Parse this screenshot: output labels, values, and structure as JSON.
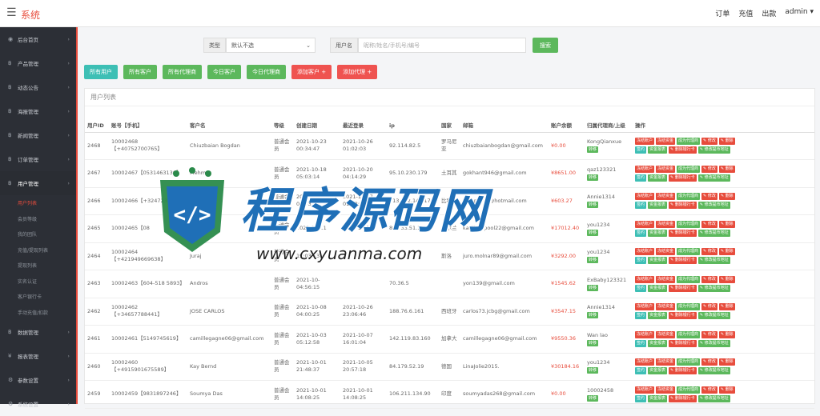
{
  "header": {
    "title": "系统",
    "links": [
      "订单",
      "充值",
      "出款"
    ],
    "user": "admin"
  },
  "sidebar": {
    "items": [
      {
        "label": "后台首页",
        "icon": "gauge-icon"
      },
      {
        "label": "产品管理",
        "icon": "bitcoin-icon"
      },
      {
        "label": "动态公告",
        "icon": "bitcoin-icon"
      },
      {
        "label": "海报管理",
        "icon": "bitcoin-icon"
      },
      {
        "label": "新闻管理",
        "icon": "bitcoin-icon"
      },
      {
        "label": "订单管理",
        "icon": "bitcoin-icon"
      },
      {
        "label": "用户管理",
        "icon": "bitcoin-icon"
      }
    ],
    "subitems": [
      "用户列表",
      "会员等级",
      "我的团队",
      "充值/提现列表",
      "提现列表",
      "实名认证",
      "客户银行卡",
      "手动充值/扣款"
    ],
    "items_after": [
      {
        "label": "数据管理",
        "icon": "bitcoin-icon"
      },
      {
        "label": "报表管理",
        "icon": "yen-icon"
      },
      {
        "label": "参数设置",
        "icon": "gear-icon"
      },
      {
        "label": "系统设置",
        "icon": "gears-icon"
      }
    ]
  },
  "filter": {
    "type_label": "类型",
    "type_value": "默认不选",
    "user_label": "用户名",
    "placeholder": "昵称/姓名/手机号/编号",
    "search": "搜索"
  },
  "buttons": [
    "所有用户",
    "所有客户",
    "所有代理商",
    "今日客户",
    "今日代理商",
    "添加客户 +",
    "添加代理 +"
  ],
  "panel_title": "用户列表",
  "columns": [
    "用户ID",
    "账号【手机】",
    "客户名",
    "等级",
    "创建日期",
    "最近登录",
    "ip",
    "国家",
    "邮箱",
    "账户余额",
    "归属代理商/上级",
    "操作"
  ],
  "rows": [
    {
      "id": "2468",
      "acct": "10002468【+40752700765】",
      "name": "Chiuzbaian Bogdan",
      "level": "普通会员",
      "created": "2021-10-23 00:34:47",
      "login": "2021-10-26 01:02:03",
      "ip": "92.114.82.5",
      "country": "罗马尼亚",
      "email": "chiuzbaianbogdan@gmail.com",
      "balance": "¥0.00",
      "agent": "KongQianxue"
    },
    {
      "id": "2467",
      "acct": "10002467【0531463136】",
      "name": "Mehmet",
      "level": "普通会员",
      "created": "2021-10-18 05:03:14",
      "login": "2021-10-20 04:14:29",
      "ip": "95.10.230.179",
      "country": "土耳其",
      "email": "gokhant946@gmail.com",
      "balance": "¥8651.00",
      "agent": "qaz123321"
    },
    {
      "id": "2466",
      "acct": "10002466【+32472370】",
      "name": "",
      "level": "普通会员",
      "created": "2021-10-16 01:43:20",
      "login": "2021-10-27 01:18:25",
      "ip": "213.132.145.174",
      "country": "比利时",
      "email": "Bct_punto@hotmail.com",
      "balance": "¥603.27",
      "agent": "Annie1314"
    },
    {
      "id": "2465",
      "acct": "10002465【08",
      "name": "",
      "level": "普通会员",
      "created": "2021-10-11",
      "login": "2021-10-18",
      "ip": "80.233.51.119",
      "country": "爱尔兰",
      "email": "karlliverpool22@gmail.com",
      "balance": "¥17012.40",
      "agent": "you1234"
    },
    {
      "id": "2464",
      "acct": "10002464【+421949669638】",
      "name": "Juraj",
      "level": "普通会员",
      "created": "19:03:13",
      "login": "",
      "ip": "",
      "country": "斯洛",
      "email": "juro.molnar89@gmail.com",
      "balance": "¥3292.00",
      "agent": "you1234"
    },
    {
      "id": "2463",
      "acct": "10002463【604-518 5893】",
      "name": "Andros",
      "level": "普通会员",
      "created": "2021-10- 04:56:15",
      "login": "",
      "ip": "70.36.5",
      "country": "",
      "email": "yon139@gmail.com",
      "balance": "¥1545.62",
      "agent": "ExBaby123321"
    },
    {
      "id": "2462",
      "acct": "10002462【+34657788441】",
      "name": "JOSE CARLOS",
      "level": "普通会员",
      "created": "2021-10-08 04:00:25",
      "login": "2021-10-26 23:06:46",
      "ip": "188.76.6.161",
      "country": "西班牙",
      "email": "carlos73.jcbg@gmail.com",
      "balance": "¥3547.15",
      "agent": "Annie1314"
    },
    {
      "id": "2461",
      "acct": "10002461【5149745619】",
      "name": "camillegagne06@gmail.com",
      "level": "普通会员",
      "created": "2021-10-03 05:12:58",
      "login": "2021-10-07 16:01:04",
      "ip": "142.119.83.160",
      "country": "加拿大",
      "email": "camillegagne06@gmail.com",
      "balance": "¥9550.36",
      "agent": "Wan lao"
    },
    {
      "id": "2460",
      "acct": "10002460【+4915901675589】",
      "name": "Kay Bernd",
      "level": "普通会员",
      "created": "2021-10-01 21:48:37",
      "login": "2021-10-05 20:57:18",
      "ip": "84.179.52.19",
      "country": "德国",
      "email": "LinaJolie2015.",
      "balance": "¥30184.16",
      "agent": "you1234"
    },
    {
      "id": "2459",
      "acct": "10002459【9831897246】",
      "name": "Soumya Das",
      "level": "普通会员",
      "created": "2021-10-01 14:08:25",
      "login": "2021-10-01 14:08:25",
      "ip": "106.211.134.90",
      "country": "印度",
      "email": "soumyadas268@gmail.com",
      "balance": "¥0.00",
      "agent": "10002458"
    }
  ],
  "actions": {
    "freeze_acct": "冻结账户",
    "freeze_fund": "冻结资金",
    "make_agent": "成为代理商",
    "edit": "✎ 修改",
    "delete": "✎ 删除",
    "sign": "签约",
    "fund_report": "资金报表",
    "del_card": "✎ 删除银行卡",
    "edit_addr": "✎ 修改提币地址",
    "transfer": "转移"
  },
  "watermark": {
    "title": "程序源码网",
    "url": "www.cxyuanma.com"
  }
}
